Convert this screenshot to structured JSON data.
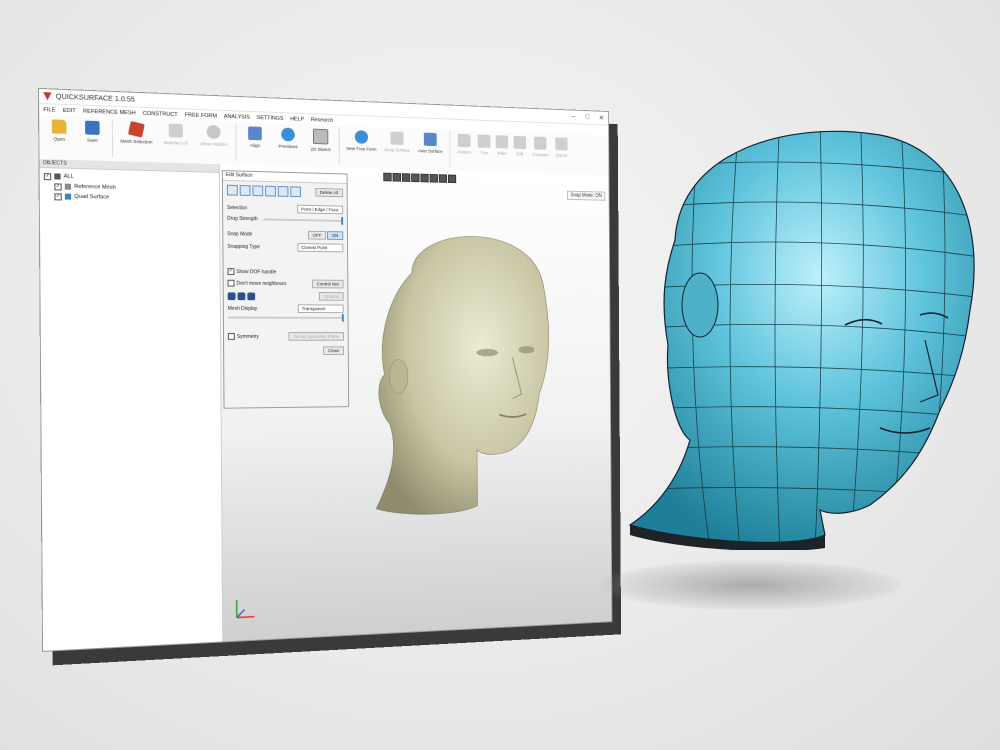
{
  "window": {
    "title": "QUICKSURFACE 1.0.55",
    "controls": [
      "–",
      "□",
      "✕"
    ]
  },
  "menu": [
    "FILE",
    "EDIT",
    "REFERENCE MESH",
    "CONSTRUCT",
    "FREE FORM",
    "ANALYSIS",
    "SETTINGS",
    "HELP",
    "Research"
  ],
  "ribbon": {
    "open": "Open",
    "save": "Save",
    "mesh_selection": "Mesh Selection",
    "deselect_all": "Deselect All",
    "show_hidden": "Show Hidden",
    "align": "Align",
    "primitives": "Primitives",
    "sketch_2d": "2D Sketch",
    "new_free_form": "New Free Form",
    "snap_surface": "Snap Surface",
    "auto_surface": "Auto Surface",
    "pattern": "Pattern",
    "trim": "Trim",
    "fillet": "Fillet",
    "edit": "Edit",
    "compare": "Compare",
    "export": "Export"
  },
  "objects": {
    "header": "OBJECTS",
    "root": "ALL",
    "items": [
      "Reference Mesh",
      "Quad Surface"
    ]
  },
  "viewport": {
    "snap_mode": "Snap Mode: ON"
  },
  "edit_surface": {
    "title": "Edit Surface",
    "delete_all": "Delete All",
    "selection_label": "Selection",
    "selection_value": "Point / Edge / Face",
    "drag_strength": "Drag Strength",
    "snap_mode_label": "Snap Mode",
    "off": "OFF",
    "on": "ON",
    "snapping_type_label": "Snapping Type",
    "snapping_type_value": "Closest Point",
    "show_dof": "Show DOF handle",
    "dont_move": "Don't move neighbours",
    "control_net": "Control Net",
    "options": "Options",
    "mesh_display_label": "Mesh Display",
    "mesh_display_value": "Transparent",
    "symmetry": "Symmetry",
    "set_symmetry": "Set as Symmetry Plane",
    "close": "Close"
  },
  "colors": {
    "mesh_head": "#c8c6a4",
    "surface_head": "#5ec3dc",
    "accent": "#3a7fd0"
  }
}
